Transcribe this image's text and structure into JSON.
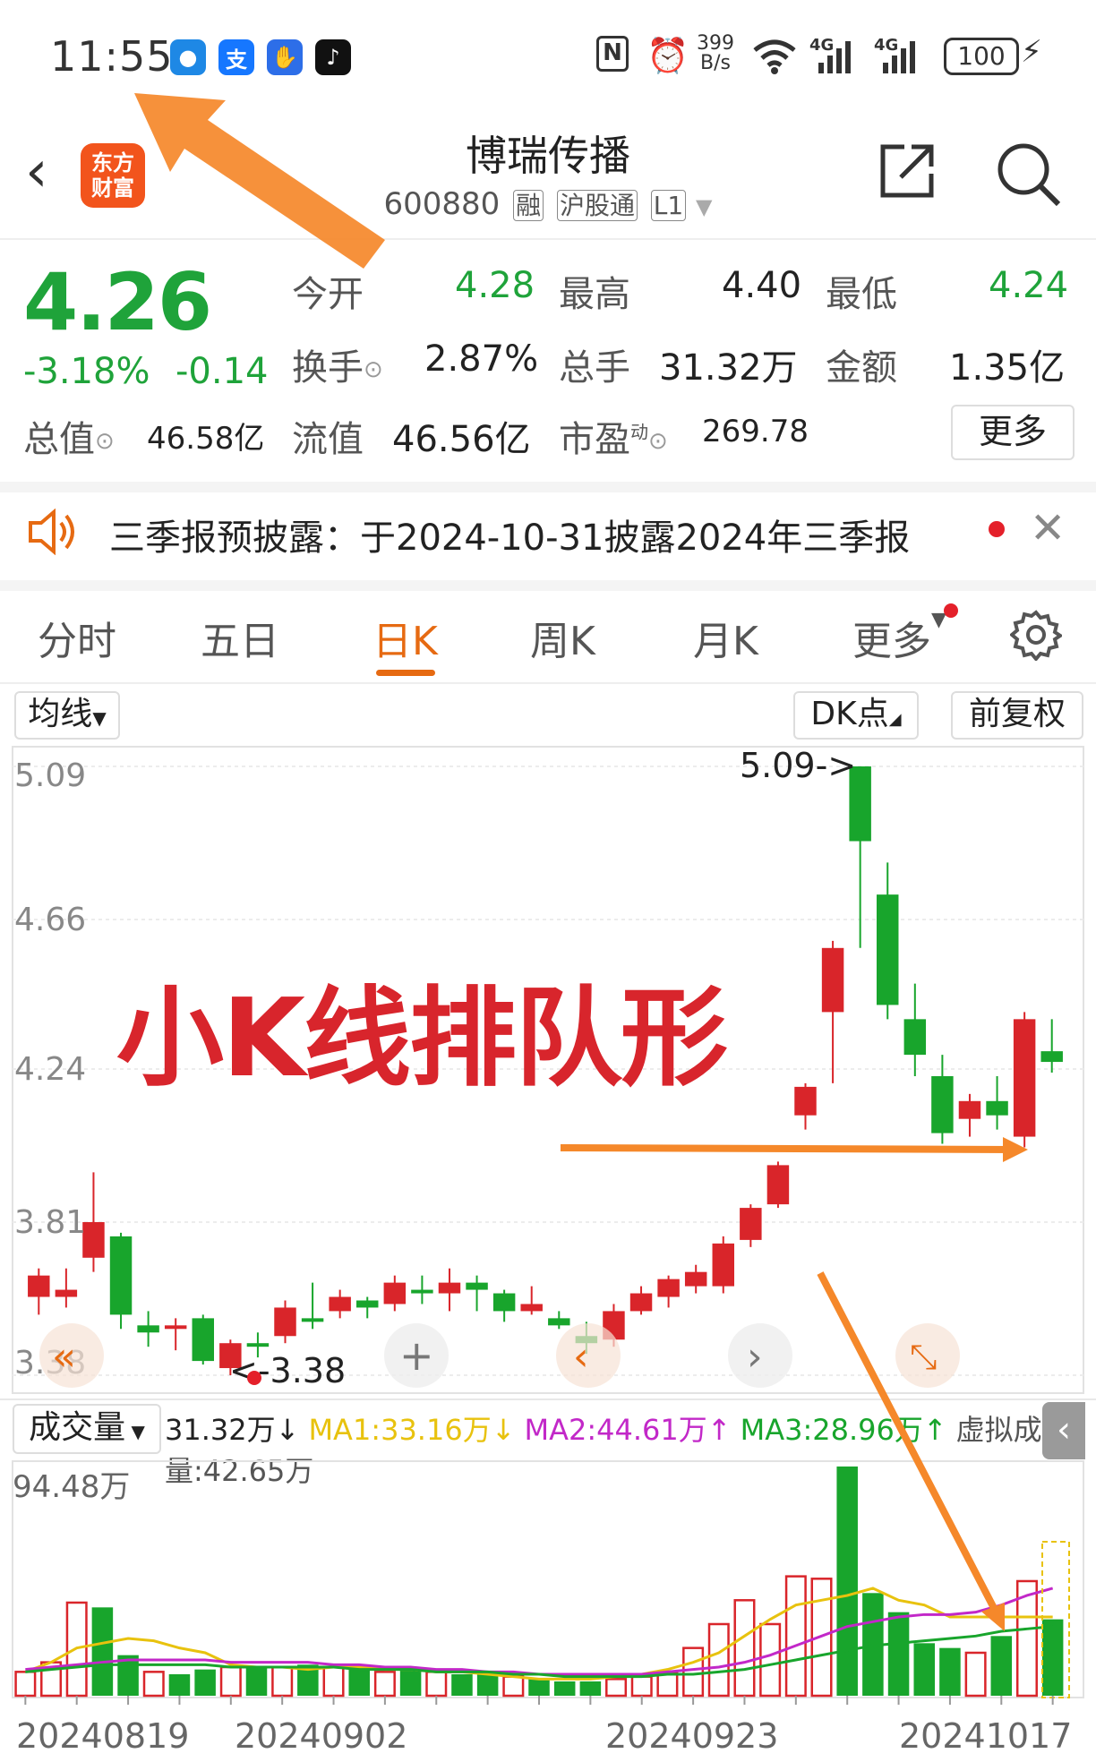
{
  "status": {
    "time": "11:55",
    "apps": [
      {
        "name": "message-app-icon",
        "glyph": "●",
        "color": "#1e88e5"
      },
      {
        "name": "alipay-app-icon",
        "glyph": "支",
        "color": "#1677ff"
      },
      {
        "name": "shield-app-icon",
        "glyph": "✋",
        "color": "#2d6ee8"
      },
      {
        "name": "tiktok-app-icon",
        "glyph": "♪",
        "color": "#111111"
      }
    ],
    "right": {
      "nfc": "N",
      "net_speed_top": "399",
      "net_speed_bottom": "B/s",
      "sig1": "4G",
      "sig2": "4G",
      "battery": "100"
    }
  },
  "header": {
    "logo_line1": "东方",
    "logo_line2": "财富",
    "stock_name": "博瑞传播",
    "stock_code": "600880",
    "tags": [
      "融",
      "沪股通",
      "L1"
    ]
  },
  "quote": {
    "price": "4.26",
    "change_pct": "-3.18%",
    "change": "-0.14",
    "stats": [
      {
        "label": "今开",
        "value": "4.28"
      },
      {
        "label": "最高",
        "value": "4.40"
      },
      {
        "label": "最低",
        "value": "4.24"
      },
      {
        "label": "换手",
        "value": "2.87%"
      },
      {
        "label": "总手",
        "value": "31.32万"
      },
      {
        "label": "金额",
        "value": "1.35亿"
      },
      {
        "label": "总值",
        "value": "46.58亿"
      },
      {
        "label": "流值",
        "value": "46.56亿"
      },
      {
        "label": "市盈",
        "value": "269.78"
      }
    ],
    "pe_sup": "动",
    "more_label": "更多"
  },
  "notice": {
    "text": "三季报预披露：于2024-10-31披露2024年三季报"
  },
  "tabs": {
    "items": [
      "分时",
      "五日",
      "日K",
      "周K",
      "月K",
      "更多"
    ],
    "active": 2
  },
  "chart_controls": {
    "ma_label": "均线",
    "dk_label": "DK点",
    "adj_label": "前复权"
  },
  "annotation": {
    "title": "小K线排队形"
  },
  "chart_data": [
    {
      "type": "candlestick",
      "title": "",
      "ylim": [
        3.38,
        5.09
      ],
      "y_ticks": [
        "5.09",
        "4.66",
        "4.24",
        "3.81",
        "3.38"
      ],
      "max_label": "5.09->",
      "min_label": "<-3.38",
      "colors": {
        "up": "#d9252a",
        "down": "#18a52c"
      },
      "candles": [
        {
          "o": 3.6,
          "h": 3.68,
          "l": 3.55,
          "c": 3.66
        },
        {
          "o": 3.6,
          "h": 3.68,
          "l": 3.57,
          "c": 3.62
        },
        {
          "o": 3.71,
          "h": 3.95,
          "l": 3.67,
          "c": 3.81
        },
        {
          "o": 3.77,
          "h": 3.78,
          "l": 3.51,
          "c": 3.55
        },
        {
          "o": 3.52,
          "h": 3.56,
          "l": 3.46,
          "c": 3.5
        },
        {
          "o": 3.51,
          "h": 3.54,
          "l": 3.45,
          "c": 3.52
        },
        {
          "o": 3.54,
          "h": 3.55,
          "l": 3.41,
          "c": 3.42
        },
        {
          "o": 3.4,
          "h": 3.48,
          "l": 3.38,
          "c": 3.47
        },
        {
          "o": 3.47,
          "h": 3.5,
          "l": 3.43,
          "c": 3.46
        },
        {
          "o": 3.49,
          "h": 3.59,
          "l": 3.47,
          "c": 3.57
        },
        {
          "o": 3.54,
          "h": 3.64,
          "l": 3.51,
          "c": 3.53
        },
        {
          "o": 3.56,
          "h": 3.62,
          "l": 3.54,
          "c": 3.6
        },
        {
          "o": 3.59,
          "h": 3.6,
          "l": 3.54,
          "c": 3.57
        },
        {
          "o": 3.58,
          "h": 3.66,
          "l": 3.56,
          "c": 3.64
        },
        {
          "o": 3.62,
          "h": 3.66,
          "l": 3.58,
          "c": 3.61
        },
        {
          "o": 3.61,
          "h": 3.68,
          "l": 3.56,
          "c": 3.64
        },
        {
          "o": 3.64,
          "h": 3.66,
          "l": 3.56,
          "c": 3.62
        },
        {
          "o": 3.61,
          "h": 3.62,
          "l": 3.53,
          "c": 3.56
        },
        {
          "o": 3.56,
          "h": 3.63,
          "l": 3.55,
          "c": 3.58
        },
        {
          "o": 3.54,
          "h": 3.56,
          "l": 3.51,
          "c": 3.52
        },
        {
          "o": 3.49,
          "h": 3.53,
          "l": 3.44,
          "c": 3.47
        },
        {
          "o": 3.48,
          "h": 3.58,
          "l": 3.46,
          "c": 3.56
        },
        {
          "o": 3.56,
          "h": 3.63,
          "l": 3.55,
          "c": 3.61
        },
        {
          "o": 3.6,
          "h": 3.66,
          "l": 3.57,
          "c": 3.65
        },
        {
          "o": 3.63,
          "h": 3.69,
          "l": 3.61,
          "c": 3.67
        },
        {
          "o": 3.63,
          "h": 3.77,
          "l": 3.61,
          "c": 3.75
        },
        {
          "o": 3.76,
          "h": 3.86,
          "l": 3.74,
          "c": 3.85
        },
        {
          "o": 3.86,
          "h": 3.98,
          "l": 3.85,
          "c": 3.97
        },
        {
          "o": 4.11,
          "h": 4.2,
          "l": 4.07,
          "c": 4.19
        },
        {
          "o": 4.4,
          "h": 4.6,
          "l": 4.2,
          "c": 4.58
        },
        {
          "o": 5.09,
          "h": 5.09,
          "l": 4.58,
          "c": 4.88
        },
        {
          "o": 4.73,
          "h": 4.82,
          "l": 4.38,
          "c": 4.42
        },
        {
          "o": 4.38,
          "h": 4.48,
          "l": 4.22,
          "c": 4.28
        },
        {
          "o": 4.22,
          "h": 4.28,
          "l": 4.03,
          "c": 4.06
        },
        {
          "o": 4.1,
          "h": 4.17,
          "l": 4.05,
          "c": 4.15
        },
        {
          "o": 4.15,
          "h": 4.22,
          "l": 4.07,
          "c": 4.11
        },
        {
          "o": 4.05,
          "h": 4.4,
          "l": 4.02,
          "c": 4.38
        },
        {
          "o": 4.29,
          "h": 4.38,
          "l": 4.23,
          "c": 4.26
        }
      ]
    },
    {
      "type": "bar",
      "title": "成交量",
      "ylim": [
        0,
        94.48
      ],
      "y_max_label": "94.48万",
      "x_ticks": [
        "20240819",
        "20240902",
        "20240923",
        "20241017"
      ],
      "legend": [
        {
          "text": "31.32万↓",
          "color": "#222222"
        },
        {
          "text": "MA1:33.16万↓",
          "color": "#e8c20e"
        },
        {
          "text": "MA2:44.61万↑",
          "color": "#c228c8"
        },
        {
          "text": "MA3:28.96万↑",
          "color": "#18a52c"
        },
        {
          "text": "虚拟成交量:42.65万",
          "color": "#555555"
        }
      ],
      "values": [
        10,
        14,
        39,
        37,
        17,
        10,
        9,
        11,
        12,
        12,
        12,
        13,
        12,
        11,
        10,
        11,
        10,
        9,
        9,
        8,
        7,
        6,
        6,
        7,
        8,
        10,
        20,
        30,
        40,
        30,
        50,
        49,
        96,
        43,
        35,
        22,
        20,
        18,
        25,
        48,
        32
      ],
      "ma1": [
        10,
        14,
        20,
        22,
        24,
        23,
        20,
        18,
        13,
        12,
        12,
        11,
        12,
        12,
        11,
        11,
        10,
        10,
        9,
        8,
        7,
        7,
        7,
        8,
        9,
        11,
        14,
        18,
        25,
        32,
        38,
        40,
        42,
        45,
        40,
        38,
        33,
        33,
        33,
        33,
        33
      ],
      "ma2": [
        11,
        12,
        13,
        14,
        15,
        15,
        15,
        15,
        14,
        14,
        14,
        14,
        13,
        13,
        12,
        12,
        11,
        11,
        10,
        10,
        9,
        9,
        9,
        9,
        9,
        10,
        11,
        12,
        14,
        17,
        21,
        25,
        29,
        31,
        33,
        34,
        34,
        35,
        38,
        42,
        45
      ],
      "ma3": [
        10,
        11,
        12,
        13,
        13,
        13,
        13,
        13,
        12,
        12,
        12,
        12,
        12,
        11,
        11,
        11,
        10,
        10,
        10,
        9,
        9,
        8,
        8,
        8,
        8,
        9,
        9,
        10,
        11,
        13,
        15,
        17,
        19,
        21,
        22,
        23,
        24,
        25,
        27,
        28,
        29
      ]
    }
  ]
}
